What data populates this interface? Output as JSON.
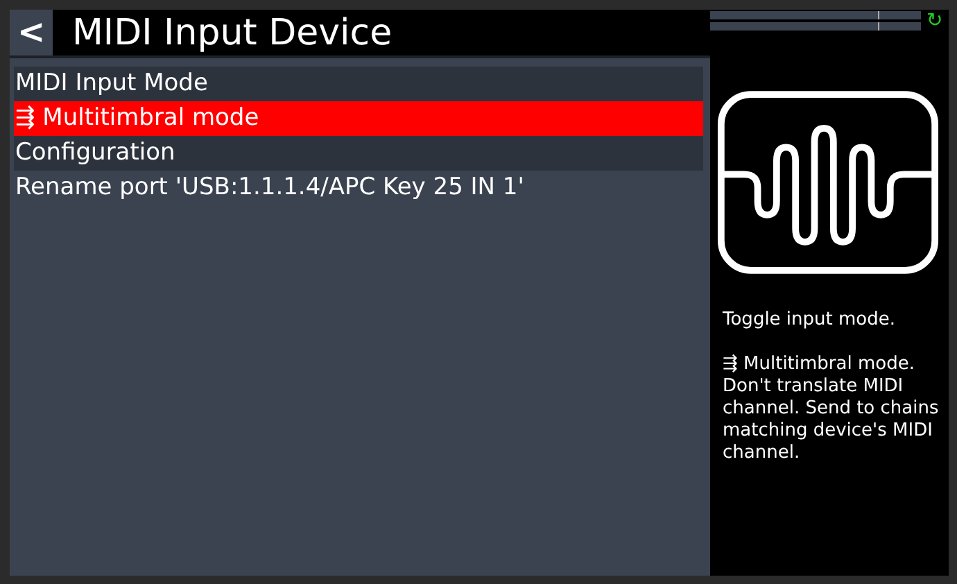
{
  "header": {
    "back_label": "<",
    "title": "MIDI Input Device"
  },
  "menu": {
    "group_items": [
      {
        "label": "MIDI Input Mode",
        "selected": false
      },
      {
        "label": "⇶ Multitimbral mode",
        "selected": true
      },
      {
        "label": "Configuration",
        "selected": false
      }
    ],
    "items": [
      {
        "label": "Rename port 'USB:1.1.1.4/APC Key 25 IN 1'",
        "selected": false
      }
    ]
  },
  "status": {
    "refresh_label": "↻"
  },
  "help": {
    "paragraphs": [
      "Toggle input mode.",
      "⇶ Multitimbral mode. Don't translate MIDI channel. Send to chains matching device's MIDI channel."
    ]
  }
}
